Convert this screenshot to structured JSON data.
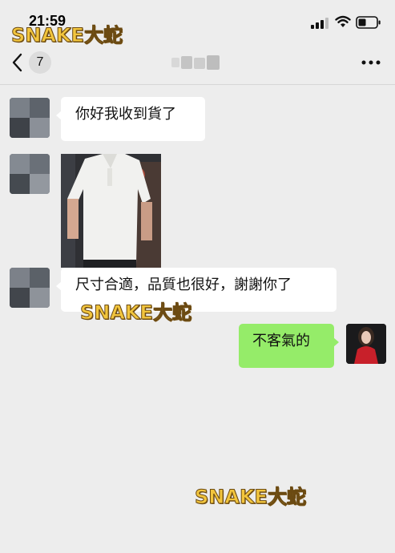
{
  "status_bar": {
    "time": "21:59"
  },
  "nav": {
    "unread_count": "7"
  },
  "messages": [
    {
      "sender": "contact",
      "type": "text",
      "text": "你好我收到貨了"
    },
    {
      "sender": "contact",
      "type": "image"
    },
    {
      "sender": "contact",
      "type": "text",
      "text": "尺寸合適，品質也很好，謝謝你了"
    },
    {
      "sender": "me",
      "type": "text",
      "text": "不客氣的"
    }
  ],
  "watermarks": [
    "SNAKE大蛇",
    "SNAKE大蛇",
    "SNAKE大蛇"
  ],
  "colors": {
    "background": "#ededed",
    "my_bubble": "#95ec69",
    "their_bubble": "#ffffff",
    "watermark": "#f2c53d"
  }
}
